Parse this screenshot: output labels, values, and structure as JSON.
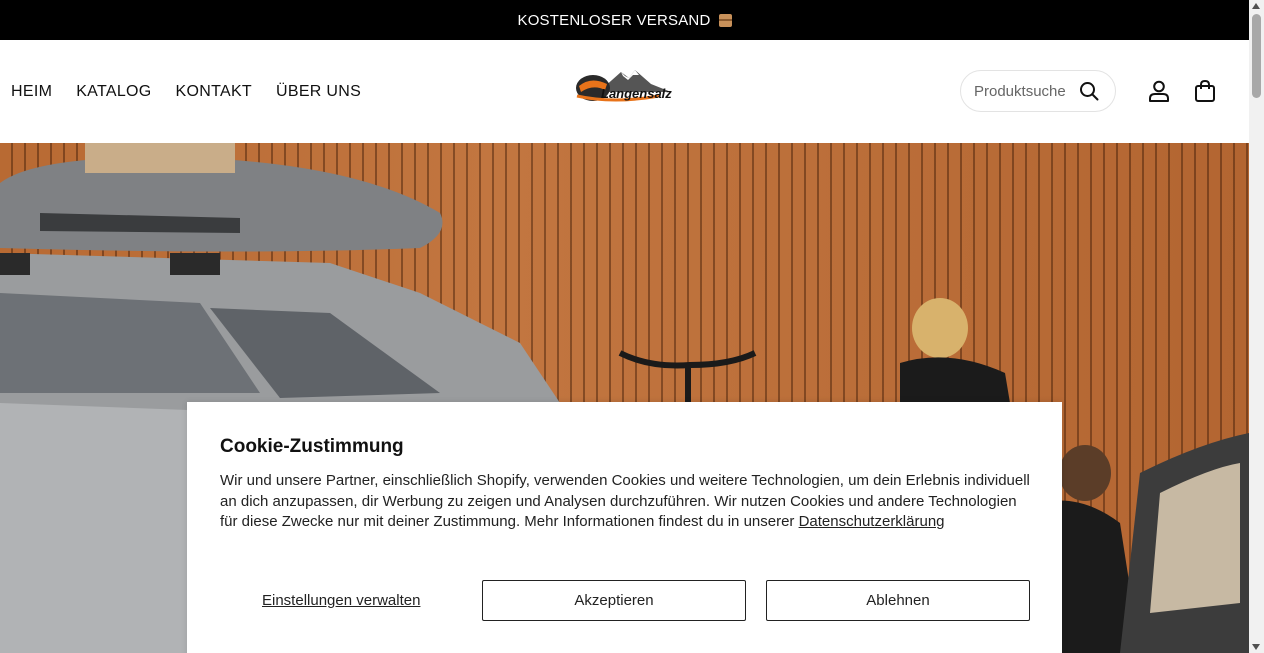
{
  "announcement": {
    "text": "KOSTENLOSER VERSAND",
    "icon": "package-icon"
  },
  "nav": {
    "items": [
      {
        "label": "HEIM"
      },
      {
        "label": "KATALOG"
      },
      {
        "label": "KONTAKT"
      },
      {
        "label": "ÜBER UNS"
      }
    ]
  },
  "logo": {
    "text": "Langensalz",
    "accent": "#e8731a"
  },
  "search": {
    "placeholder": "Produktsuche"
  },
  "icons": {
    "search": "search-icon",
    "account": "user-icon",
    "cart": "shopping-bag-icon"
  },
  "cookie": {
    "title": "Cookie-Zustimmung",
    "body": "Wir und unsere Partner, einschließlich Shopify, verwenden Cookies und weitere Technologien, um dein Erlebnis individuell an dich anzupassen, dir Werbung zu zeigen und Analysen durchzuführen. Wir nutzen Cookies und andere Technologien für diese Zwecke nur mit deiner Zustimmung. Mehr Informationen findest du in unserer ",
    "privacy_link": "Datenschutzerklärung",
    "manage_label": "Einstellungen verwalten",
    "accept_label": "Akzeptieren",
    "decline_label": "Ablehnen"
  }
}
